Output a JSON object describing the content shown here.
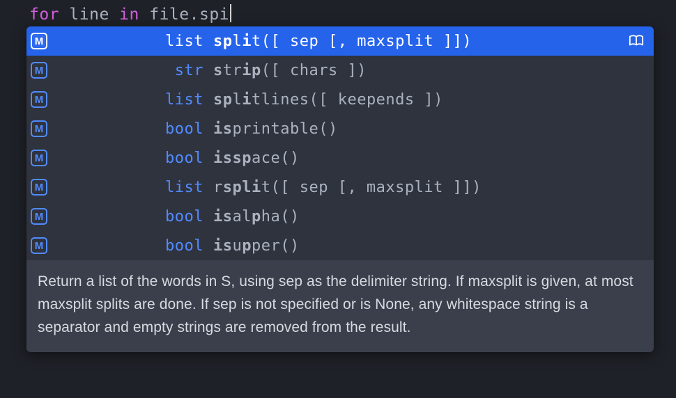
{
  "editor": {
    "tokens": {
      "for": "for",
      "line_var": "line",
      "in": "in",
      "file_var": "file",
      "partial": "spi"
    }
  },
  "completions": [
    {
      "kind": "M",
      "ret": "list",
      "sig_html": "<span class='b'>sp</span>l<span class='b'>i</span>t([ sep [, maxsplit ]])",
      "selected": true,
      "has_doc_icon": true
    },
    {
      "kind": "M",
      "ret": "str",
      "sig_html": "<span class='b'>s</span>tr<span class='b'>ip</span>([ chars ])"
    },
    {
      "kind": "M",
      "ret": "list",
      "sig_html": "<span class='b'>sp</span>l<span class='b'>i</span>tlines([ keepends ])"
    },
    {
      "kind": "M",
      "ret": "bool",
      "sig_html": "<span class='b'>is</span>printable()"
    },
    {
      "kind": "M",
      "ret": "bool",
      "sig_html": "<span class='b'>issp</span>ace()"
    },
    {
      "kind": "M",
      "ret": "list",
      "sig_html": "r<span class='b'>spli</span>t([ sep [, maxsplit ]])"
    },
    {
      "kind": "M",
      "ret": "bool",
      "sig_html": "<span class='b'>is</span>al<span class='b'>p</span>ha()"
    },
    {
      "kind": "M",
      "ret": "bool",
      "sig_html": "<span class='b'>is</span>u<span class='b'>p</span>per()"
    }
  ],
  "doc": "Return a list of the words in S, using sep as the delimiter string. If maxsplit is given, at most maxsplit splits are done. If sep is not specified or is None, any whitespace string is a separator and empty strings are removed from the result.",
  "colors": {
    "bg": "#1e2127",
    "popup_bg": "#2f333e",
    "selected_bg": "#2563eb",
    "accent_blue": "#528bff",
    "keyword": "#d55fde",
    "text": "#abb2bf"
  }
}
